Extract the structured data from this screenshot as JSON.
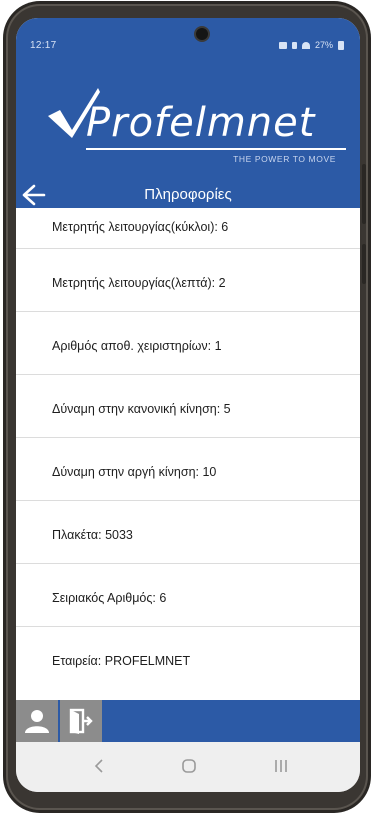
{
  "status_bar": {
    "time": "12:17",
    "battery": "27%"
  },
  "logo": {
    "wordmark": "Profelmnet",
    "tagline": "THE POWER TO MOVE"
  },
  "title_bar": {
    "title": "Πληροφορίες"
  },
  "info_items": [
    {
      "text": "Μετρητής λειτουργίας(κύκλοι): 6"
    },
    {
      "text": "Μετρητής λειτουργίας(λεπτά): 2"
    },
    {
      "text": "Αριθμός αποθ. χειριστηρίων: 1"
    },
    {
      "text": "Δύναμη στην κανονική κίνηση: 5"
    },
    {
      "text": "Δύναμη στην αργή κίνηση: 10"
    },
    {
      "text": "Πλακέτα: 5033"
    },
    {
      "text": "Σειριακός Αριθμός: 6"
    },
    {
      "text": "Εταιρεία: PROFELMNET"
    }
  ],
  "colors": {
    "brand_blue": "#2c5aa6",
    "button_gray": "#8c8c8c"
  },
  "icons": {
    "back": "arrow-left-icon",
    "profile": "user-icon",
    "logout": "logout-icon",
    "nav_back": "chevron-left-icon",
    "nav_home": "home-icon",
    "nav_recents": "recents-icon"
  }
}
